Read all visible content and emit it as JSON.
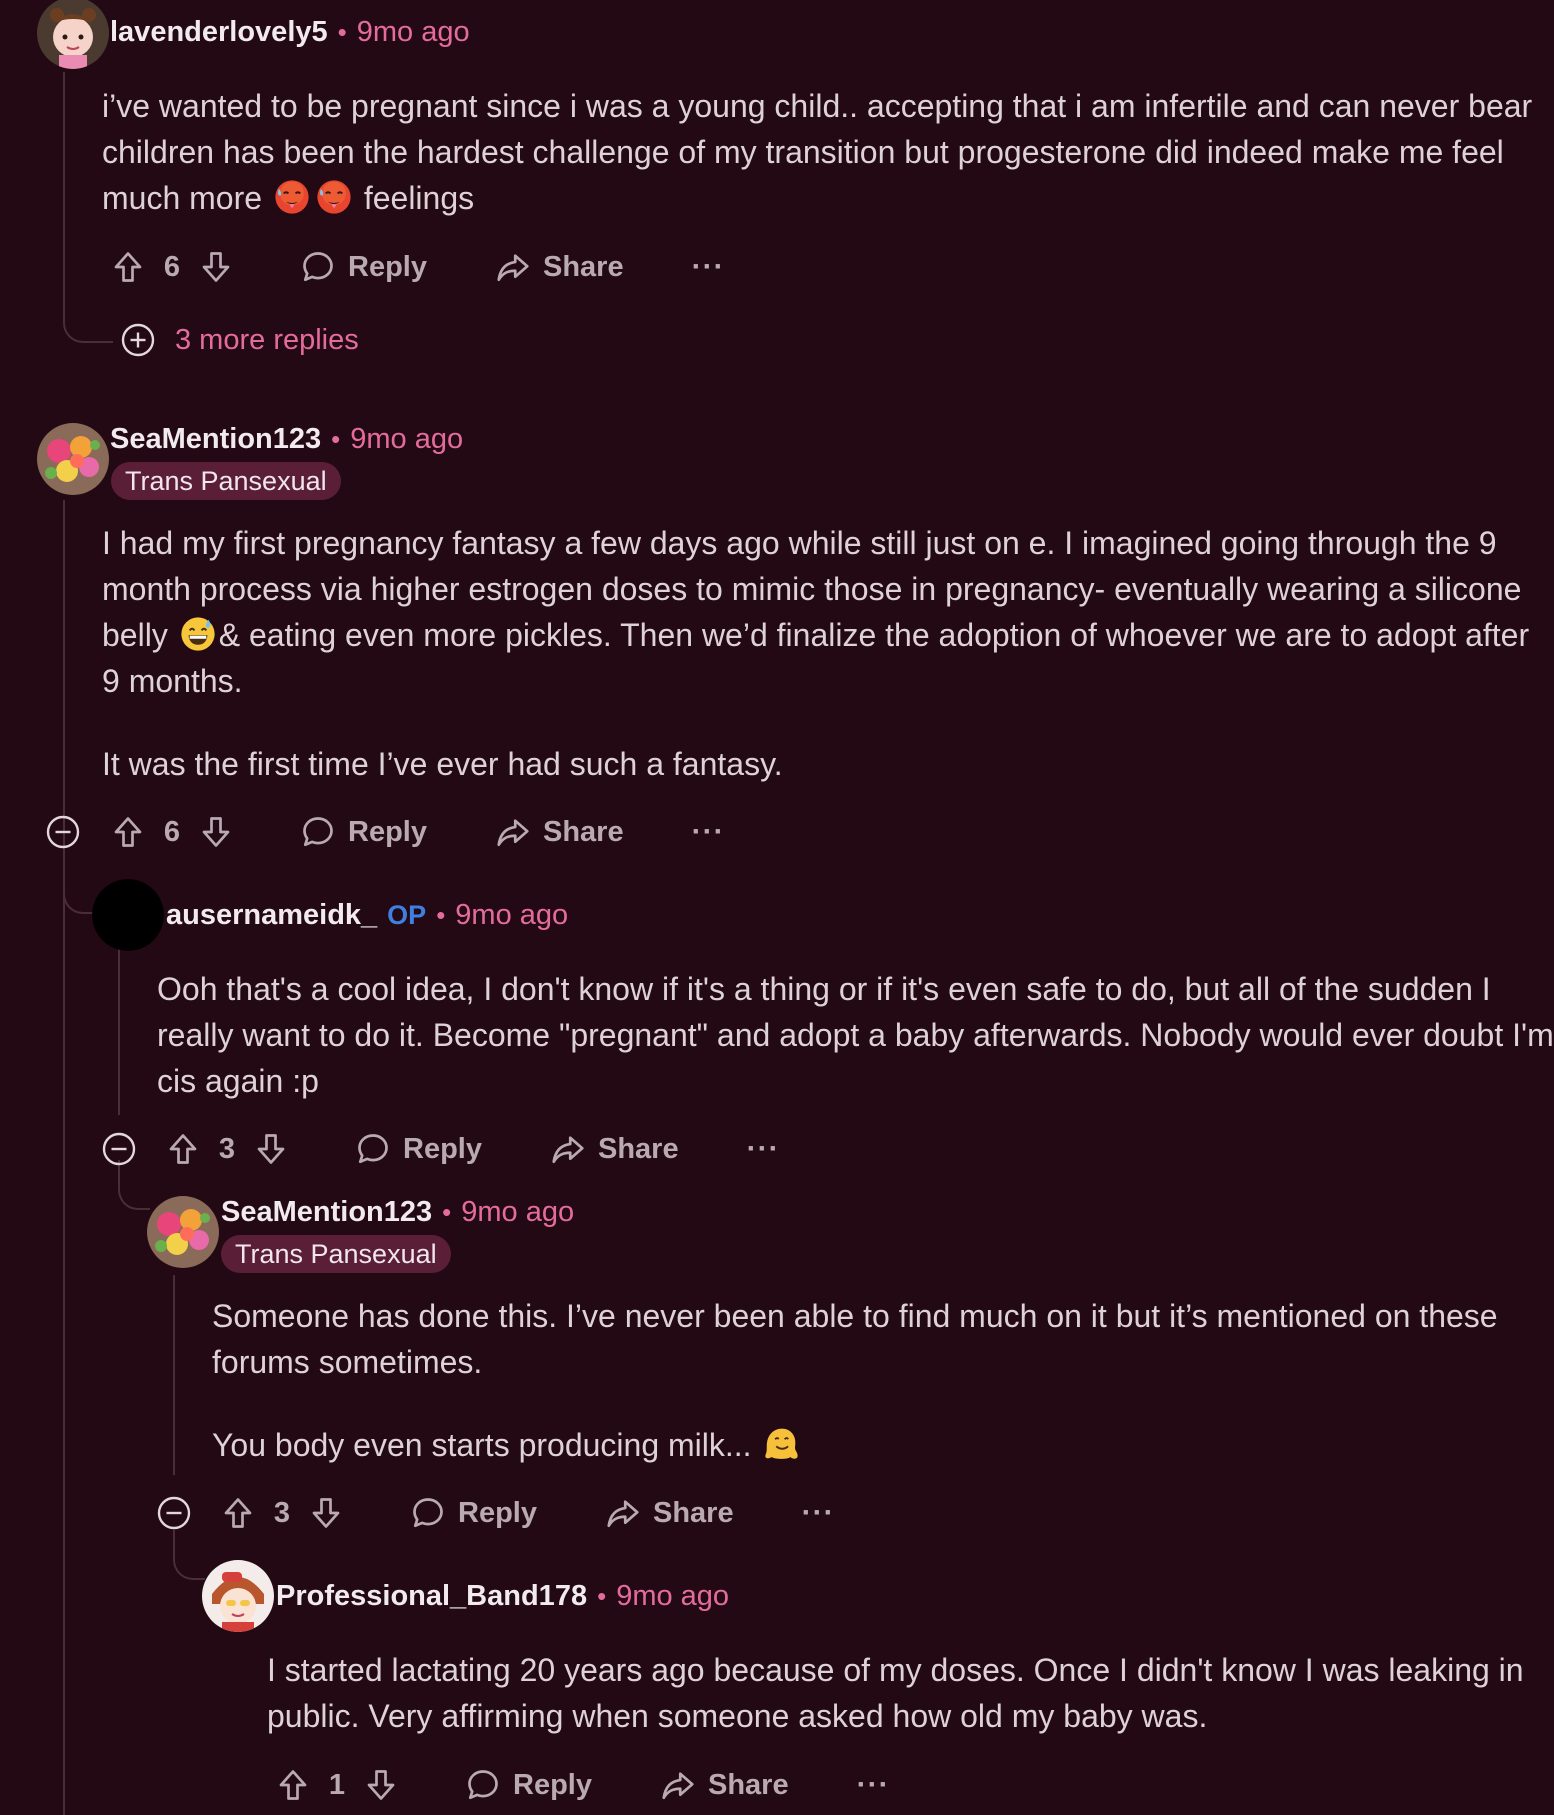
{
  "colors": {
    "background": "#230913",
    "accent": "#e46c9c",
    "flair_bg": "#5a1f36",
    "op": "#3e7fe0"
  },
  "comments": [
    {
      "username": "lavenderlovely5",
      "time": "9mo ago",
      "body_1": "i’ve wanted to be pregnant since i was a young child.. accepting that i am infertile and can never bear children has been the hardest challenge of my transition but progesterone did indeed make me feel much more",
      "body_emoji": "hot-face-emoji",
      "body_2": "feelings",
      "votes": "6",
      "reply_label": "Reply",
      "share_label": "Share",
      "more_label": "···",
      "more_replies_label": "3 more replies"
    },
    {
      "username": "SeaMention123",
      "time": "9mo ago",
      "flair": "Trans Pansexual",
      "para1_a": "I had my first pregnancy fantasy a few days ago while still just on e. I imagined going through the 9 month process via higher estrogen doses to mimic those in pregnancy- eventually wearing a silicone belly",
      "para1_emoji": "grinning-sweat-emoji",
      "para1_b": "& eating even more pickles. Then we’d finalize the adoption of whoever we are to adopt after 9 months.",
      "para2": "It was the first time I’ve ever had such a fantasy.",
      "votes": "6",
      "reply_label": "Reply",
      "share_label": "Share",
      "more_label": "···"
    },
    {
      "username": "ausernameidk_",
      "op_label": "OP",
      "time": "9mo ago",
      "body": "Ooh that's a cool idea, I don't know if it's a thing or if it's even safe to do, but all of the sudden I really want to do it. Become \"pregnant\" and adopt a baby afterwards. Nobody would ever doubt I'm cis again :p",
      "votes": "3",
      "reply_label": "Reply",
      "share_label": "Share",
      "more_label": "···"
    },
    {
      "username": "SeaMention123",
      "time": "9mo ago",
      "flair": "Trans Pansexual",
      "para1": "Someone has done this. I’ve never been able to find much on it but it’s mentioned on these forums sometimes.",
      "para2": "You body even starts producing milk...",
      "para2_emoji": "melting-face-emoji",
      "votes": "3",
      "reply_label": "Reply",
      "share_label": "Share",
      "more_label": "···"
    },
    {
      "username": "Professional_Band178",
      "time": "9mo ago",
      "body": "I started lactating 20 years ago because of my doses. Once I didn't know I was leaking in public. Very affirming when someone asked how old my baby was.",
      "votes": "1",
      "reply_label": "Reply",
      "share_label": "Share",
      "more_label": "···"
    }
  ]
}
